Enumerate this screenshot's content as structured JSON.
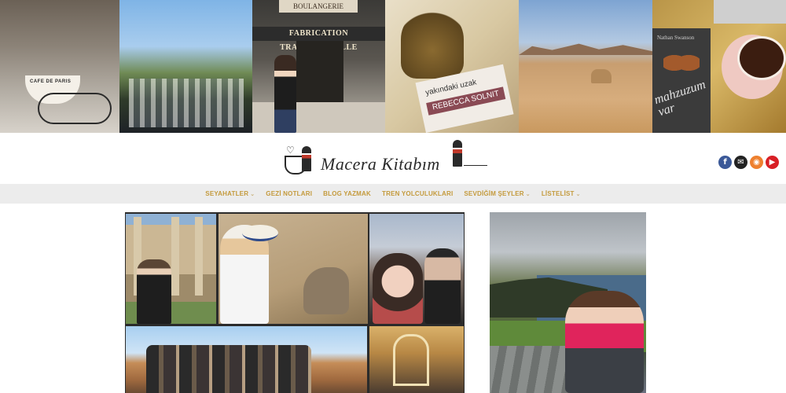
{
  "header": {
    "photos": [
      {
        "name": "cafe-de-paris-cup",
        "cup_text": "CAFE DE PARIS"
      },
      {
        "name": "wine-glasses-vineyard"
      },
      {
        "name": "boulangerie-storefront",
        "sign_top": "BOULANGERIE",
        "sign_main": "FABRICATION TRADITIONNELLE"
      },
      {
        "name": "book-rebecca-solnit",
        "book_title": "yakındaki uzak",
        "book_author": "REBECCA SOLNIT"
      },
      {
        "name": "desert-camels"
      },
      {
        "name": "book-mahzuzum-var",
        "book_author": "Nathan Swanson",
        "book_title": "mahzuzum var"
      }
    ]
  },
  "logo": {
    "text": "Macera Kitabım"
  },
  "social": {
    "facebook": "f",
    "email": "✉",
    "rss": "◉",
    "youtube": "▶"
  },
  "nav": {
    "items": [
      {
        "label": "SEYAHATLER",
        "dropdown": true
      },
      {
        "label": "GEZİ NOTLARI",
        "dropdown": false
      },
      {
        "label": "BLOG YAZMAK",
        "dropdown": false
      },
      {
        "label": "TREN YOLCULUKLARI",
        "dropdown": false
      },
      {
        "label": "SEVDİĞİM ŞEYLER",
        "dropdown": true
      },
      {
        "label": "LİSTELİST",
        "dropdown": true
      }
    ],
    "chevron": "⌄"
  },
  "colors": {
    "nav_text": "#c49a3c",
    "nav_bg": "#ececec",
    "facebook": "#3b5998",
    "rss": "#ee802f",
    "youtube": "#d81f26"
  }
}
